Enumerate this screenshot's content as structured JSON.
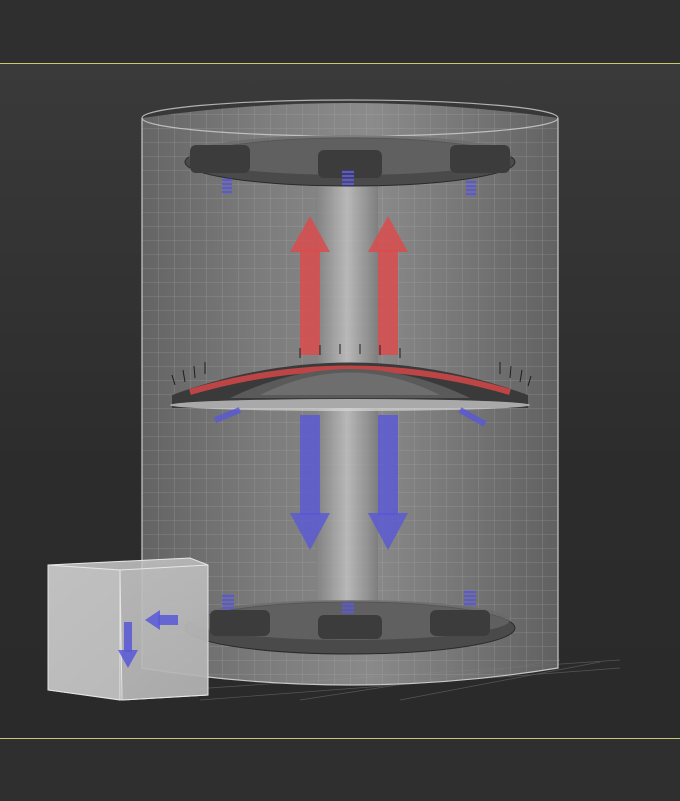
{
  "scene": {
    "view": "3d-perspective-viewport",
    "objects": [
      {
        "name": "transparent-cylinder-tank",
        "display": "wireframe-over-shaded"
      },
      {
        "name": "central-shaft"
      },
      {
        "name": "top-impeller-disc"
      },
      {
        "name": "middle-bristle-disc"
      },
      {
        "name": "bottom-impeller-disc"
      },
      {
        "name": "spring-coils",
        "count": 6
      }
    ],
    "flow_arrows": {
      "up_color": "#e04848",
      "down_color": "#5858d8",
      "up_count": 2,
      "down_count": 2
    },
    "view_cube": {
      "label_visible": false
    }
  },
  "colors": {
    "viewport_bg": "#2e2e2e",
    "frame_line": "#c8c870",
    "mesh_line": "#b8b8b8",
    "up_arrow": "#e04848",
    "down_arrow": "#5858d8"
  }
}
